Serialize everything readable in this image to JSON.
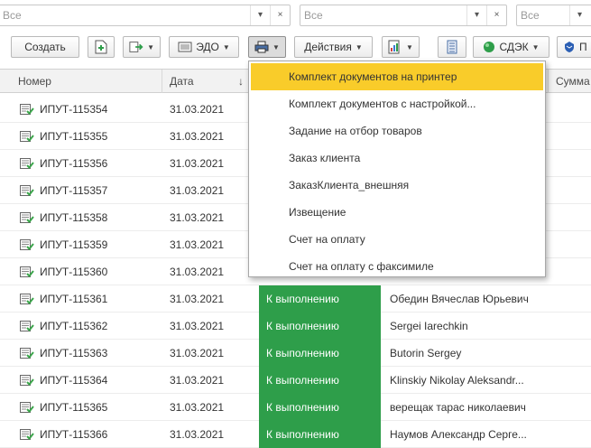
{
  "filters": [
    {
      "value": "Все",
      "dropdown_icon": "▾",
      "clear_icon": "×"
    },
    {
      "value": "Все",
      "dropdown_icon": "▾",
      "clear_icon": "×"
    },
    {
      "value": "Все",
      "dropdown_icon": "▾"
    }
  ],
  "toolbar": {
    "create_label": "Создать",
    "edo_label": "ЭДО",
    "actions_label": "Действия",
    "cdek_label": "СДЭК",
    "truncated_label": "П"
  },
  "columns": {
    "number": "Номер",
    "date": "Дата",
    "sort_indicator": "↓",
    "sum": "Сумма"
  },
  "print_menu": {
    "items": [
      "Комплект документов на принтер",
      "Комплект документов с настройкой...",
      "Задание на отбор товаров",
      "Заказ клиента",
      "ЗаказКлиента_внешняя",
      "Извещение",
      "Счет на оплату",
      "Счет на оплату с факсимиле"
    ],
    "highlighted_index": 0
  },
  "rows": [
    {
      "number": "ИПУТ-115354",
      "date": "31.03.2021",
      "status": "",
      "client": ""
    },
    {
      "number": "ИПУТ-115355",
      "date": "31.03.2021",
      "status": "",
      "client": ""
    },
    {
      "number": "ИПУТ-115356",
      "date": "31.03.2021",
      "status": "",
      "client": ""
    },
    {
      "number": "ИПУТ-115357",
      "date": "31.03.2021",
      "status": "",
      "client": ""
    },
    {
      "number": "ИПУТ-115358",
      "date": "31.03.2021",
      "status": "",
      "client": ""
    },
    {
      "number": "ИПУТ-115359",
      "date": "31.03.2021",
      "status": "",
      "client": ""
    },
    {
      "number": "ИПУТ-115360",
      "date": "31.03.2021",
      "status": "",
      "client": ""
    },
    {
      "number": "ИПУТ-115361",
      "date": "31.03.2021",
      "status": "К выполнению",
      "client": "Обедин Вячеслав Юрьевич"
    },
    {
      "number": "ИПУТ-115362",
      "date": "31.03.2021",
      "status": "К выполнению",
      "client": "Sergei Iarechkin"
    },
    {
      "number": "ИПУТ-115363",
      "date": "31.03.2021",
      "status": "К выполнению",
      "client": "Butorin Sergey"
    },
    {
      "number": "ИПУТ-115364",
      "date": "31.03.2021",
      "status": "К выполнению",
      "client": "Klinskiy Nikolay Aleksandr..."
    },
    {
      "number": "ИПУТ-115365",
      "date": "31.03.2021",
      "status": "К выполнению",
      "client": "верещак тарас николаевич"
    },
    {
      "number": "ИПУТ-115366",
      "date": "31.03.2021",
      "status": "К выполнению",
      "client": "Наумов Александр Серге..."
    }
  ],
  "colors": {
    "status_bg": "#2e9e4a",
    "menu_highlight": "#f9cc2a",
    "doc_icon_green": "#3aa54a"
  }
}
